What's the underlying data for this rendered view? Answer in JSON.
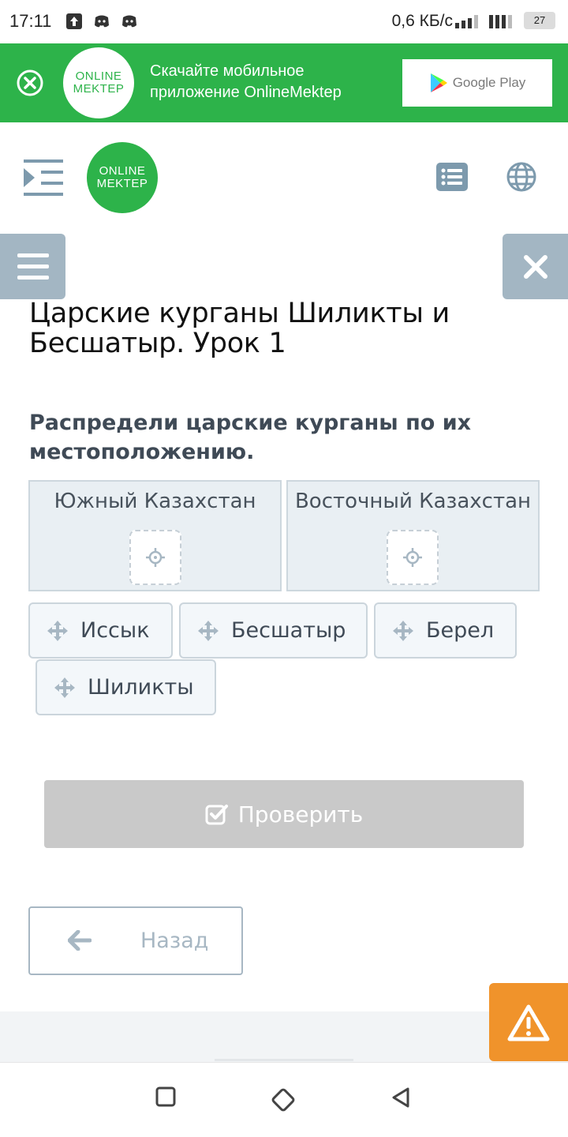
{
  "status_bar": {
    "time": "17:11",
    "network_speed": "0,6 КБ/с",
    "battery": "27",
    "left_icons": [
      "upload-icon",
      "discord-icon",
      "discord-icon"
    ],
    "right_icons": [
      "signal-icon",
      "signal-icon"
    ]
  },
  "promo_banner": {
    "logo_line1": "ONLINE",
    "logo_line2": "MEKTEP",
    "text": "Скачайте мобильное приложение OnlineMektep",
    "store_label": "Google Play",
    "color": "#2db34a"
  },
  "header": {
    "logo_line1": "ONLINE",
    "logo_line2": "MEKTEP",
    "icons": [
      "menu-indent-icon",
      "list-icon",
      "globe-icon"
    ]
  },
  "side_tabs": {
    "left_icon": "hamburger-icon",
    "right_icon": "close-icon"
  },
  "lesson": {
    "title": "Царские курганы Шиликты и Бесшатыр. Урок 1",
    "task": "Распредели царские курганы по их местоположению."
  },
  "drop_zones": [
    {
      "label": "Южный Казахстан"
    },
    {
      "label": "Восточный Казахстан"
    }
  ],
  "drag_items": [
    {
      "label": "Иссык"
    },
    {
      "label": "Бесшатыр"
    },
    {
      "label": "Берел"
    },
    {
      "label": "Шиликты"
    }
  ],
  "buttons": {
    "check": "Проверить",
    "back": "Назад"
  },
  "colors": {
    "brand_green": "#2db34a",
    "side_tab": "#a3b6c3",
    "warning": "#f0932b",
    "disabled": "#c9c9c9"
  }
}
